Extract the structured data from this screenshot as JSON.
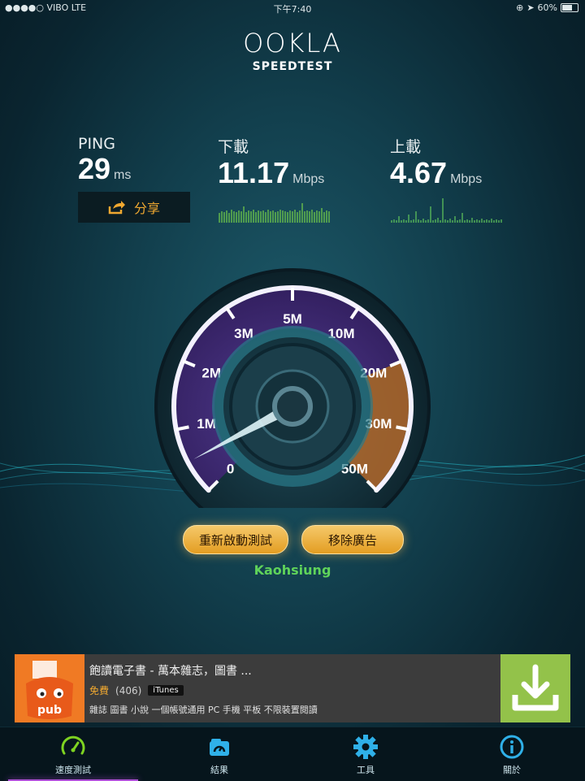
{
  "status": {
    "carrier": "●●●●○ VIBO  LTE",
    "time": "下午7:40",
    "battery": "60%"
  },
  "logo": {
    "brand": "OOKLA",
    "subtitle": "SPEEDTEST"
  },
  "ping": {
    "label": "PING",
    "value": "29",
    "unit": "ms"
  },
  "download": {
    "label": "下載",
    "value": "11.17",
    "unit": "Mbps"
  },
  "upload": {
    "label": "上載",
    "value": "4.67",
    "unit": "Mbps"
  },
  "share": {
    "label": "分享"
  },
  "gauge": {
    "ticks": [
      "0",
      "1M",
      "2M",
      "3M",
      "5M",
      "10M",
      "20M",
      "30M",
      "50M"
    ],
    "needle_value": 0.5
  },
  "buttons": {
    "restart": "重新啟動測試",
    "remove_ads": "移除廣告"
  },
  "server": "Kaohsiung",
  "ad": {
    "title": "飽讀電子書 - 萬本雜志，圖書 ...",
    "price": "免費",
    "rating_count": "(406)",
    "store": "iTunes",
    "description": "雜誌 圖書 小說 一個帳號通用 PC 手機 平板 不限裝置閱讀",
    "icon_text": "pub"
  },
  "tabs": [
    {
      "label": "速度測試",
      "icon": "speedometer-icon"
    },
    {
      "label": "結果",
      "icon": "results-icon"
    },
    {
      "label": "工具",
      "icon": "gear-icon"
    },
    {
      "label": "關於",
      "icon": "info-icon"
    }
  ],
  "colors": {
    "accent_orange": "#f0a830",
    "server_green": "#5fd35a",
    "download_bar": "#6fc84a",
    "ad_download": "#93c24a",
    "tab_active": "#b050d8",
    "tab_icon": "#2fb0e8"
  }
}
